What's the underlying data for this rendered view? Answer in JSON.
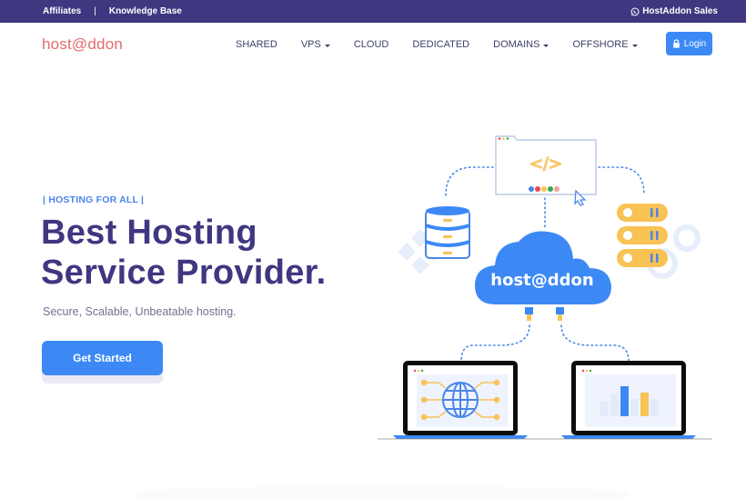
{
  "topbar": {
    "links": [
      "Affiliates",
      "Knowledge Base"
    ],
    "separator": "|",
    "sales_label": "HostAddon Sales",
    "sales_icon": "whatsapp-icon"
  },
  "nav": {
    "logo": "host@ddon",
    "items": [
      {
        "label": "SHARED",
        "dropdown": false
      },
      {
        "label": "VPS",
        "dropdown": true
      },
      {
        "label": "CLOUD",
        "dropdown": false
      },
      {
        "label": "DEDICATED",
        "dropdown": false
      },
      {
        "label": "DOMAINS",
        "dropdown": true
      },
      {
        "label": "OFFSHORE",
        "dropdown": true
      }
    ],
    "login_label": "Login",
    "login_icon": "lock-icon"
  },
  "hero": {
    "tagline": "| HOSTING FOR ALL |",
    "headline_line1": "Best Hosting",
    "headline_line2": "Service Provider.",
    "subtitle": "Secure, Scalable, Unbeatable hosting.",
    "cta_label": "Get Started"
  },
  "illustration": {
    "cloud_label": "host@ddon",
    "code_symbol": "</>",
    "icons": [
      "browser-window-icon",
      "database-icon",
      "server-rack-icon",
      "cloud-icon",
      "laptop-globe-icon",
      "laptop-chart-icon",
      "gear-icon",
      "cursor-icon"
    ]
  },
  "colors": {
    "brand_purple": "#3f3780",
    "accent_blue": "#3c89f6",
    "logo_red": "#e46a6e",
    "accent_yellow": "#f8c255"
  }
}
